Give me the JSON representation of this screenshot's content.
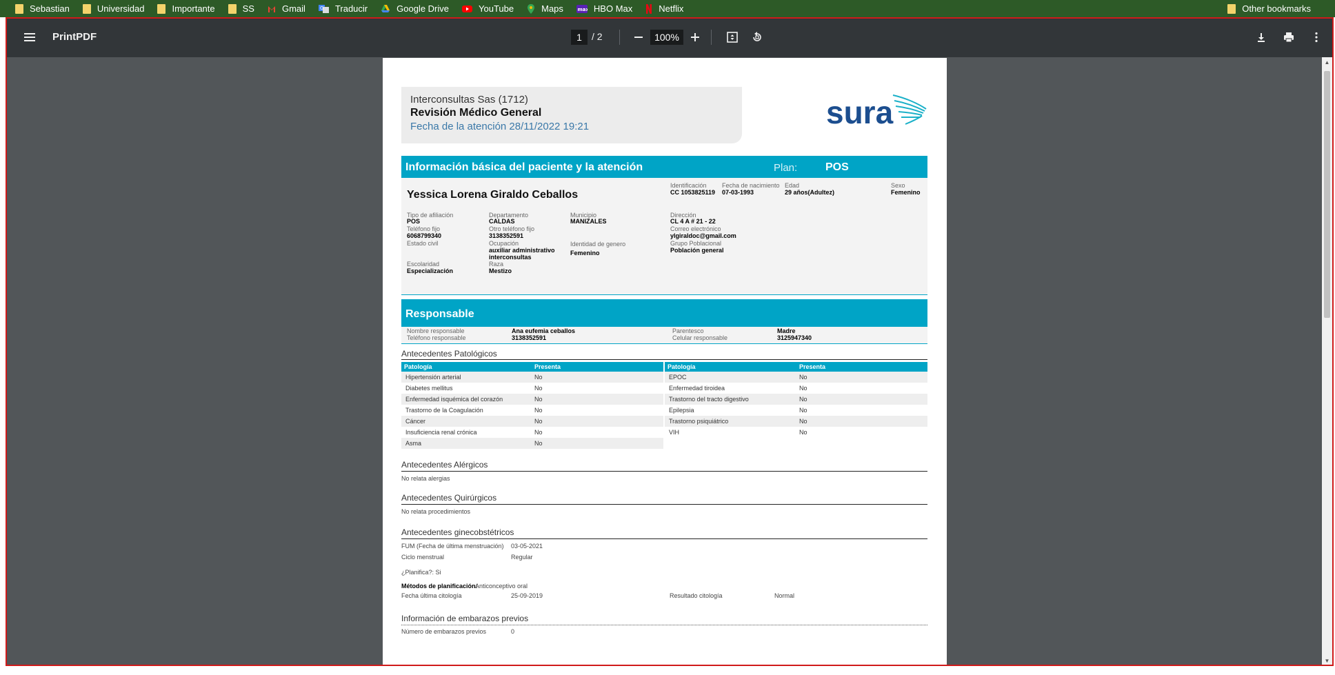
{
  "bookmarks": {
    "items": [
      {
        "label": "Sebastian",
        "icon": "folder-icon"
      },
      {
        "label": "Universidad",
        "icon": "folder-icon"
      },
      {
        "label": "Importante",
        "icon": "folder-icon"
      },
      {
        "label": "SS",
        "icon": "folder-icon"
      },
      {
        "label": "Gmail",
        "icon": "gmail-icon"
      },
      {
        "label": "Traducir",
        "icon": "translate-icon"
      },
      {
        "label": "Google Drive",
        "icon": "drive-icon"
      },
      {
        "label": "YouTube",
        "icon": "youtube-icon"
      },
      {
        "label": "Maps",
        "icon": "maps-icon"
      },
      {
        "label": "HBO Max",
        "icon": "hbo-icon"
      },
      {
        "label": "Netflix",
        "icon": "netflix-icon"
      }
    ],
    "other": "Other bookmarks"
  },
  "toolbar": {
    "title": "PrintPDF",
    "page_current": "1",
    "page_total": "/ 2",
    "zoom": "100%"
  },
  "doc": {
    "header": {
      "clinic": "Interconsultas  Sas (1712)",
      "exam": "Revisión Médico General",
      "fecha": "Fecha de la atención 28/11/2022 19:21",
      "logo": "sura"
    },
    "basic": {
      "title": "Información básica del paciente y la atención",
      "plan_label": "Plan:",
      "plan_value": "POS",
      "name": "Yessica Lorena Giraldo Ceballos",
      "top_fields": [
        {
          "label": "Identificación",
          "value": "CC 1053825119"
        },
        {
          "label": "Fecha de nacimiento",
          "value": "07-03-1993"
        },
        {
          "label": "Edad",
          "value": "29 años(Adultez)"
        },
        {
          "label": "Sexo",
          "value": "Femenino"
        }
      ],
      "tipo_afiliacion": {
        "label": "Tipo de afiliación",
        "value": "POS"
      },
      "departamento": {
        "label": "Departamento",
        "value": "CALDAS"
      },
      "municipio": {
        "label": "Municipio",
        "value": "MANIZALES"
      },
      "direccion": {
        "label": "Dirección",
        "value": "CL 4 A # 21 - 22"
      },
      "telefono_fijo": {
        "label": "Teléfono fijo",
        "value": "6068799340"
      },
      "otro_telefono": {
        "label": "Otro teléfono fijo",
        "value": "3138352591"
      },
      "correo": {
        "label": "Correo electrónico",
        "value": "ylgiraldoc@gmail.com"
      },
      "estado_civil": {
        "label": "Estado civil",
        "value": ""
      },
      "ocupacion": {
        "label": "Ocupación",
        "value": "auxiliar administrativo",
        "value2": "interconsultas"
      },
      "identidad_genero": {
        "label": "Identidad de genero",
        "value": "Femenino"
      },
      "grupo_poblacional": {
        "label": "Grupo Poblacional",
        "value": "Población general"
      },
      "escolaridad": {
        "label": "Escolaridad",
        "value": "Especialización"
      },
      "raza": {
        "label": "Raza",
        "value": "Mestizo"
      }
    },
    "responsable": {
      "title": "Responsable",
      "nombre_label": "Nombre responsable",
      "nombre_value": "Ana eufemia ceballos",
      "telefono_label": "Teléfono responsable",
      "telefono_value": "3138352591",
      "parentesco_label": "Parentesco",
      "parentesco_value": "Madre",
      "celular_label": "Celular responsable",
      "celular_value": "3125947340"
    },
    "patologicos": {
      "title": "Antecedentes Patológicos",
      "col_patologia": "Patología",
      "col_presenta": "Presenta",
      "left": [
        {
          "name": "Hipertensión arterial",
          "value": "No"
        },
        {
          "name": "Diabetes mellitus",
          "value": "No"
        },
        {
          "name": "Enfermedad isquémica del corazón",
          "value": "No"
        },
        {
          "name": "Trastorno de la Coagulación",
          "value": "No"
        },
        {
          "name": "Cáncer",
          "value": "No"
        },
        {
          "name": "Insuficiencia renal crónica",
          "value": "No"
        },
        {
          "name": "Asma",
          "value": "No"
        }
      ],
      "right": [
        {
          "name": "EPOC",
          "value": "No"
        },
        {
          "name": "Enfermedad tiroidea",
          "value": "No"
        },
        {
          "name": "Trastorno del tracto digestivo",
          "value": "No"
        },
        {
          "name": "Epilepsia",
          "value": "No"
        },
        {
          "name": "Trastorno psiquiátrico",
          "value": "No"
        },
        {
          "name": "VIH",
          "value": "No"
        }
      ]
    },
    "alergicos": {
      "title": "Antecedentes Alérgicos",
      "text": "No relata alergias"
    },
    "quirurgicos": {
      "title": "Antecedentes Quirúrgicos",
      "text": "No relata procedimientos"
    },
    "gineco": {
      "title": "Antecedentes ginecobstétricos",
      "fum_label": "FUM (Fecha de última menstruación)",
      "fum_value": "03-05-2021",
      "ciclo_label": "Ciclo menstrual",
      "ciclo_value": "Regular",
      "planifica": "¿Planifica?: Si",
      "metodos_label": "Métodos de planificación:",
      "metodos_value": "Anticonceptivo oral",
      "citologia_label": "Fecha última citología",
      "citologia_value": "25-09-2019",
      "resultado_label": "Resultado citología",
      "resultado_value": "Normal"
    },
    "embarazos": {
      "title": "Información de embarazos previos",
      "num_label": "Número de embarazos previos",
      "num_value": "0"
    }
  },
  "colors": {
    "accent": "#00a4c6",
    "brand": "#1c4e8f",
    "toolbar": "#323639",
    "viewer_bg": "#525659",
    "bookmarks_bg": "#2d5a27"
  }
}
